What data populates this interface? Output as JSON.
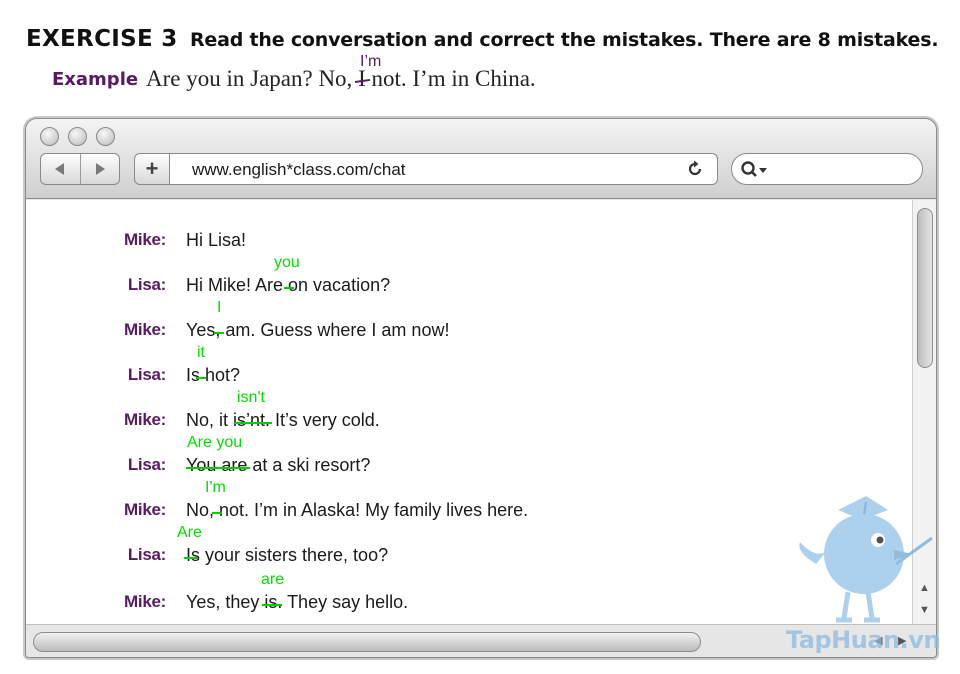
{
  "exercise": {
    "title": "EXERCISE 3",
    "instruction": "Read the conversation and correct the mistakes. There are 8 mistakes."
  },
  "example": {
    "label": "Example",
    "text_before": "Are you in Japan? No, ",
    "struck": "I",
    "text_after": " not. I’m in China.",
    "correction": "I’m"
  },
  "browser": {
    "url": "www.english*class.com/chat",
    "nav_back_icon": "back-arrow-icon",
    "nav_forward_icon": "forward-arrow-icon",
    "new_tab_label": "+",
    "reload_icon": "reload-icon",
    "search_icon": "search-icon"
  },
  "conversation": [
    {
      "speaker": "Mike:",
      "text": "Hi Lisa!",
      "correction": ""
    },
    {
      "speaker": "Lisa:",
      "text": "Hi Mike! Are on vacation?",
      "correction": "you"
    },
    {
      "speaker": "Mike:",
      "text": "Yes, am. Guess where I am now!",
      "correction": "I"
    },
    {
      "speaker": "Lisa:",
      "text": "Is hot?",
      "correction": "it"
    },
    {
      "speaker": "Mike:",
      "text": "No, it is’nt. It’s very cold.",
      "correction": "isn't"
    },
    {
      "speaker": "Lisa:",
      "text": "You are at a ski resort?",
      "correction": "Are you"
    },
    {
      "speaker": "Mike:",
      "text": "No, not. I’m in Alaska! My family lives here.",
      "correction": "I'm"
    },
    {
      "speaker": "Lisa:",
      "text": "Is your sisters there, too?",
      "correction": "Are"
    },
    {
      "speaker": "Mike:",
      "text": "Yes, they is. They say hello.",
      "correction": "are"
    }
  ],
  "watermark": "TapHuan.vn",
  "colors": {
    "speaker": "#5a1a63",
    "correction": "#00e000",
    "watermark": "#8dbbe0"
  }
}
